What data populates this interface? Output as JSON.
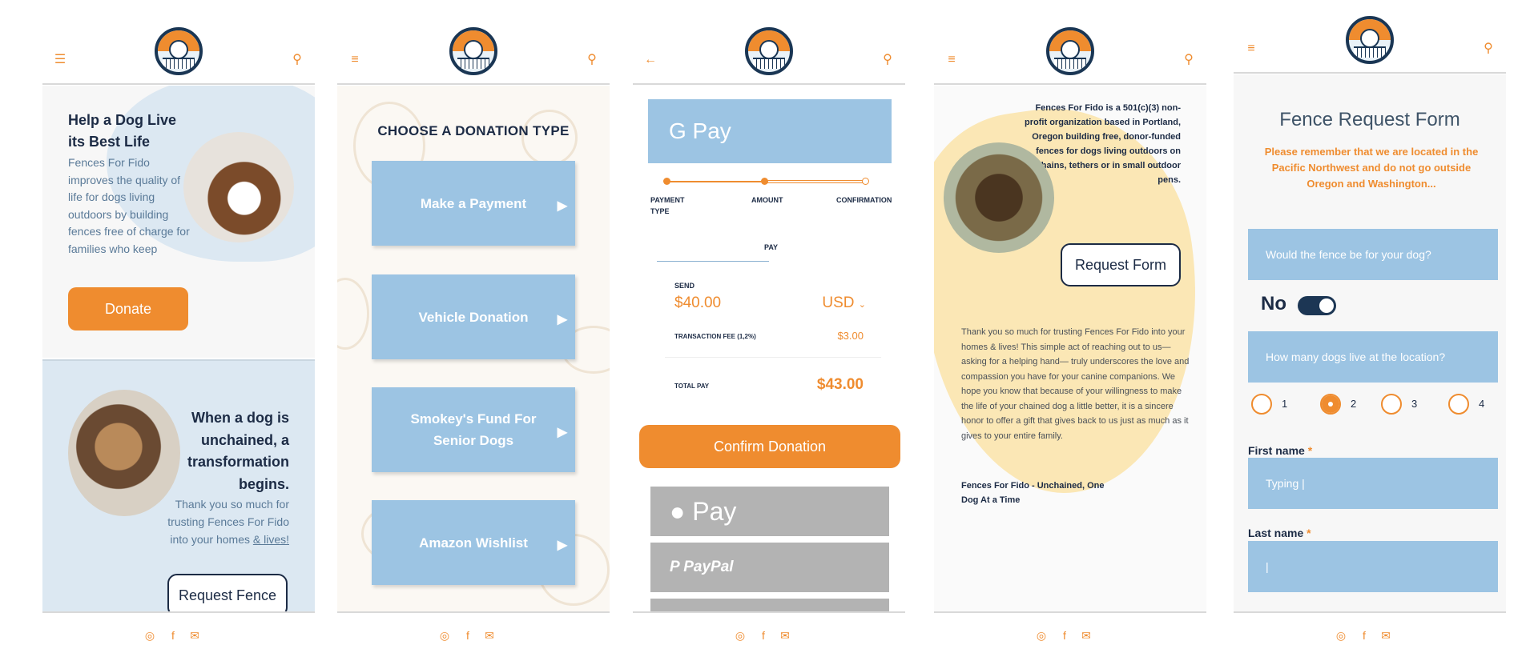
{
  "header": {
    "menu_icon": "hamburger-icon",
    "search_icon": "search-icon",
    "back_icon": "arrow-left-icon"
  },
  "footer": {
    "icons": [
      "instagram-icon",
      "facebook-icon",
      "mail-icon"
    ]
  },
  "home": {
    "hero_title": "Help a Dog Live its Best Life",
    "hero_text": "Fences For Fido improves the quality of life for dogs living outdoors by building fences free of charge for families who keep",
    "donate_label": "Donate",
    "section_title": "When a dog is unchained, a transformation begins.",
    "section_text": "Thank you so much for trusting Fences For Fido into your homes",
    "section_link": "& lives!",
    "request_label": "Request Fence"
  },
  "donation": {
    "title": "CHOOSE A DONATION TYPE",
    "options": [
      "Make a Payment",
      "Vehicle Donation",
      "Smokey's Fund For Senior Dogs",
      "Amazon Wishlist"
    ]
  },
  "payment": {
    "gpay": "G Pay",
    "steps": [
      "PAYMENT TYPE",
      "AMOUNT",
      "CONFIRMATION"
    ],
    "tab": "PAY",
    "send_label": "SEND",
    "amount": "$40.00",
    "currency": "USD",
    "fee_label": "TRANSACTION FEE (1,2%)",
    "fee": "$3.00",
    "total_label": "TOTAL PAY",
    "total": "$43.00",
    "confirm_label": "Confirm Donation",
    "apple_pay": "Pay",
    "paypal": "PayPal"
  },
  "about": {
    "intro": "Fences For Fido is a 501(c)(3) non-profit organization based in Portland, Oregon building free, donor-funded fences for dogs living outdoors on chains, tethers or in small outdoor pens.",
    "request_label": "Request Form",
    "body": "Thank you so much for trusting Fences For Fido into your homes & lives! This simple act of reaching out to us—asking for a helping hand— truly underscores the love and compassion you have for your canine companions. We hope you know that because of your willingness to make the life of your chained dog a little better, it is a sincere honor to offer a gift that gives back to us just as much as it gives to your entire family.",
    "tagline": "Fences For Fido - Unchained, One Dog At a Time"
  },
  "form": {
    "title": "Fence Request Form",
    "note": "Please remember that we are located in the Pacific Northwest and do not go outside Oregon and Washington...",
    "q1": "Would the fence be for your dog?",
    "toggle_label": "No",
    "q2": "How many dogs live at the location?",
    "radio_options": [
      "1",
      "2",
      "3",
      "4"
    ],
    "radio_selected": "2",
    "first_name_label": "First name",
    "first_name_value": "Typing",
    "last_name_label": "Last name",
    "required_mark": "*"
  },
  "colors": {
    "accent": "#ef8c2f",
    "blue": "#9cc4e3",
    "navy": "#1c2b45",
    "grey": "#b3b3b3"
  }
}
